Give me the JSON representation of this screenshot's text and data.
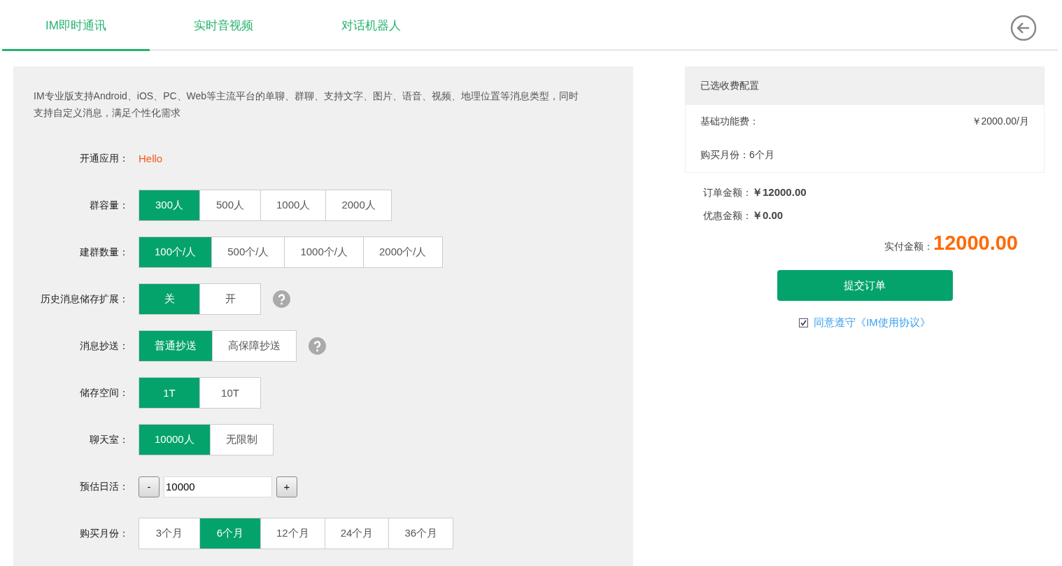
{
  "tabs": [
    {
      "label": "IM即时通讯",
      "selected": true
    },
    {
      "label": "实时音视频",
      "selected": false
    },
    {
      "label": "对话机器人",
      "selected": false
    }
  ],
  "description": "IM专业版支持Android、iOS、PC、Web等主流平台的单聊、群聊、支持文字、图片、语音、视频、地理位置等消息类型，同时支持自定义消息，满足个性化需求",
  "form": [
    {
      "kind": "text",
      "label": "开通应用：",
      "value": "Hello"
    },
    {
      "kind": "options",
      "label": "群容量：",
      "help": false,
      "options": [
        {
          "label": "300人",
          "selected": true
        },
        {
          "label": "500人",
          "selected": false
        },
        {
          "label": "1000人",
          "selected": false
        },
        {
          "label": "2000人",
          "selected": false
        }
      ]
    },
    {
      "kind": "options",
      "label": "建群数量：",
      "help": false,
      "options": [
        {
          "label": "100个/人",
          "selected": true
        },
        {
          "label": "500个/人",
          "selected": false
        },
        {
          "label": "1000个/人",
          "selected": false
        },
        {
          "label": "2000个/人",
          "selected": false
        }
      ]
    },
    {
      "kind": "options",
      "label": "历史消息储存扩展：",
      "help": true,
      "options": [
        {
          "label": "关",
          "selected": true
        },
        {
          "label": "开",
          "selected": false
        }
      ]
    },
    {
      "kind": "options",
      "label": "消息抄送：",
      "help": true,
      "options": [
        {
          "label": "普通抄送",
          "selected": true
        },
        {
          "label": "高保障抄送",
          "selected": false
        }
      ]
    },
    {
      "kind": "options",
      "label": "储存空间：",
      "help": false,
      "options": [
        {
          "label": "1T",
          "selected": true
        },
        {
          "label": "10T",
          "selected": false
        }
      ]
    },
    {
      "kind": "options",
      "label": "聊天室：",
      "help": false,
      "options": [
        {
          "label": "10000人",
          "selected": true
        },
        {
          "label": "无限制",
          "selected": false
        }
      ]
    },
    {
      "kind": "stepper",
      "label": "预估日活：",
      "minus": "-",
      "value": "10000",
      "plus": "+"
    },
    {
      "kind": "options",
      "label": "购买月份：",
      "help": false,
      "options": [
        {
          "label": "3个月",
          "selected": false
        },
        {
          "label": "6个月",
          "selected": true
        },
        {
          "label": "12个月",
          "selected": false
        },
        {
          "label": "24个月",
          "selected": false
        },
        {
          "label": "36个月",
          "selected": false
        }
      ]
    }
  ],
  "summary": {
    "title": "已选收费配置",
    "items": [
      {
        "label": "基础功能费：",
        "value": "￥2000.00/月"
      },
      {
        "label": "购买月份：",
        "value": "6个月"
      }
    ],
    "order_total": {
      "label": "订单金额：",
      "value": "￥12000.00"
    },
    "discount": {
      "label": "优惠金额：",
      "value": "￥0.00"
    },
    "pay": {
      "label": "实付金额：",
      "value": "12000.00"
    },
    "submit": "提交订单",
    "agreement": {
      "checked": true,
      "text": "同意遵守《IM使用协议》"
    }
  }
}
